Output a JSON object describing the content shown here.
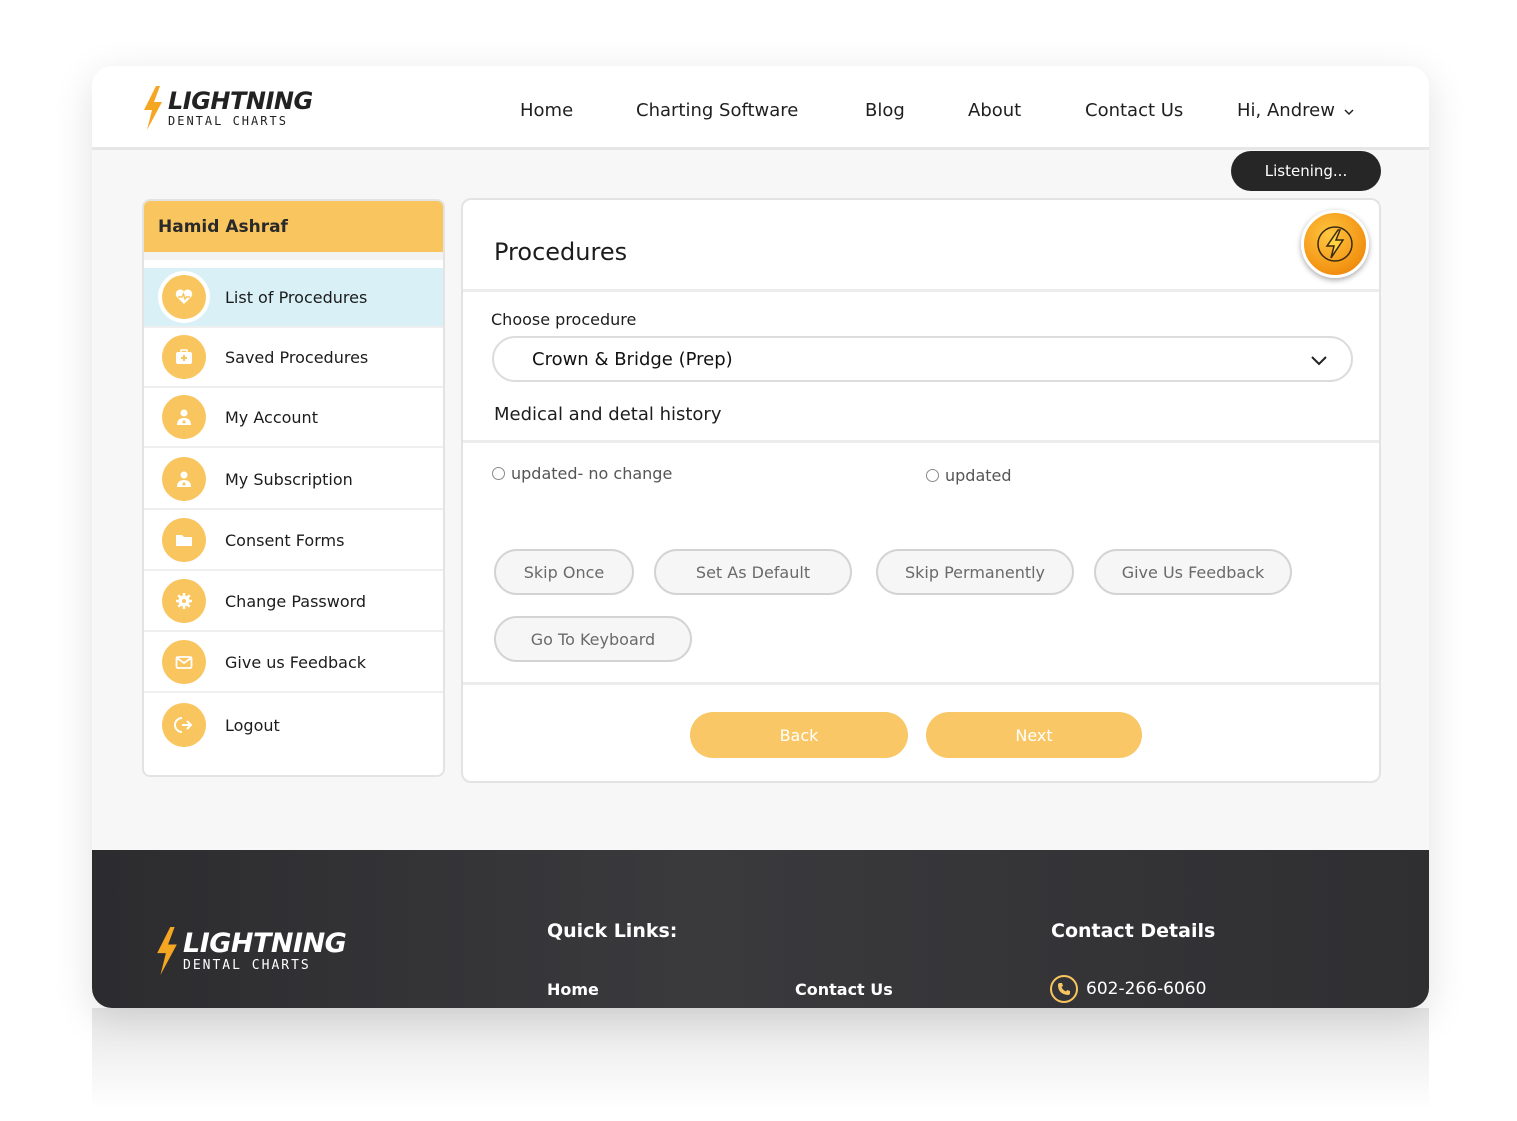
{
  "brand": {
    "name": "LIGHTNING",
    "tagline": "DENTAL CHARTS"
  },
  "nav": {
    "items": [
      "Home",
      "Charting Software",
      "Blog",
      "About",
      "Contact Us"
    ],
    "user_greeting": "Hi, Andrew",
    "user_menu_icon": "chevron-down-icon"
  },
  "status": {
    "listening": "Listening..."
  },
  "sidebar": {
    "patient_name": "Hamid Ashraf",
    "items": [
      {
        "label": "List of Procedures",
        "icon": "heart-pulse-icon",
        "active": true
      },
      {
        "label": "Saved Procedures",
        "icon": "medical-kit-icon",
        "active": false
      },
      {
        "label": "My Account",
        "icon": "user-doctor-icon",
        "active": false
      },
      {
        "label": "My Subscription",
        "icon": "user-doctor-icon",
        "active": false
      },
      {
        "label": "Consent Forms",
        "icon": "folder-icon",
        "active": false
      },
      {
        "label": "Change Password",
        "icon": "gear-icon",
        "active": false
      },
      {
        "label": "Give us Feedback",
        "icon": "envelope-icon",
        "active": false
      },
      {
        "label": "Logout",
        "icon": "logout-icon",
        "active": false
      }
    ]
  },
  "main": {
    "title": "Procedures",
    "choose_label": "Choose procedure",
    "selected_procedure": "Crown & Bridge (Prep)",
    "section_label": "Medical and detal history",
    "radio_options": [
      "updated- no change",
      "updated"
    ],
    "actions": [
      "Skip Once",
      "Set As Default",
      "Skip Permanently",
      "Give Us Feedback",
      "Go To Keyboard"
    ],
    "back_label": "Back",
    "next_label": "Next"
  },
  "footer": {
    "quick_links_heading": "Quick Links:",
    "contact_heading": "Contact Details",
    "links": [
      "Home",
      "Contact Us"
    ],
    "phone": "602-266-6060"
  },
  "colors": {
    "accent": "#f8c55e",
    "active_bg": "#d9f0f7",
    "dark": "#262626"
  }
}
